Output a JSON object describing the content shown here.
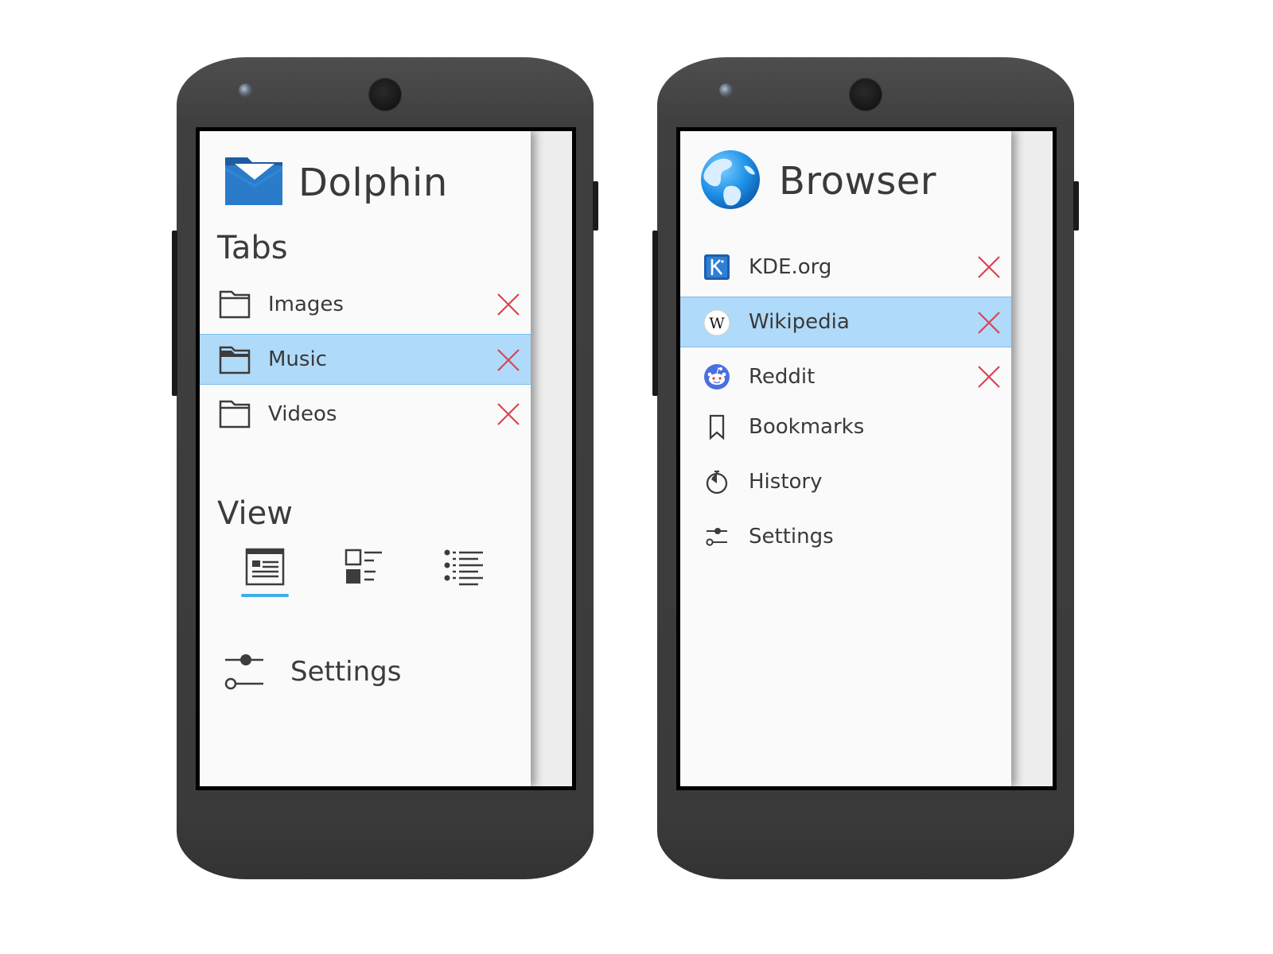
{
  "dolphin": {
    "app_title": "Dolphin",
    "app_icon": "folder-blue-icon",
    "tabs_heading": "Tabs",
    "tabs": [
      {
        "label": "Images",
        "icon": "folder-icon",
        "selected": false
      },
      {
        "label": "Music",
        "icon": "folder-icon",
        "selected": true
      },
      {
        "label": "Videos",
        "icon": "folder-icon",
        "selected": false
      }
    ],
    "view_heading": "View",
    "view_modes": [
      {
        "icon": "view-details-icon",
        "active": true
      },
      {
        "icon": "view-icons-icon",
        "active": false
      },
      {
        "icon": "view-list-tree-icon",
        "active": false
      }
    ],
    "settings_label": "Settings"
  },
  "browser": {
    "app_title": "Browser",
    "app_icon": "globe-icon",
    "items": [
      {
        "label": "KDE.org",
        "icon": "kde-logo-icon",
        "closable": true,
        "selected": false
      },
      {
        "label": "Wikipedia",
        "icon": "wikipedia-icon",
        "closable": true,
        "selected": true
      },
      {
        "label": "Reddit",
        "icon": "reddit-icon",
        "closable": true,
        "selected": false
      },
      {
        "label": "Bookmarks",
        "icon": "bookmark-icon",
        "closable": false,
        "selected": false
      },
      {
        "label": "History",
        "icon": "history-icon",
        "closable": false,
        "selected": false
      },
      {
        "label": "Settings",
        "icon": "settings-sliders-icon",
        "closable": false,
        "selected": false
      }
    ]
  },
  "colors": {
    "selection": "#b0daf9",
    "accent": "#3daee9",
    "close": "#da4453",
    "phone_body": "#3f3f3f"
  }
}
